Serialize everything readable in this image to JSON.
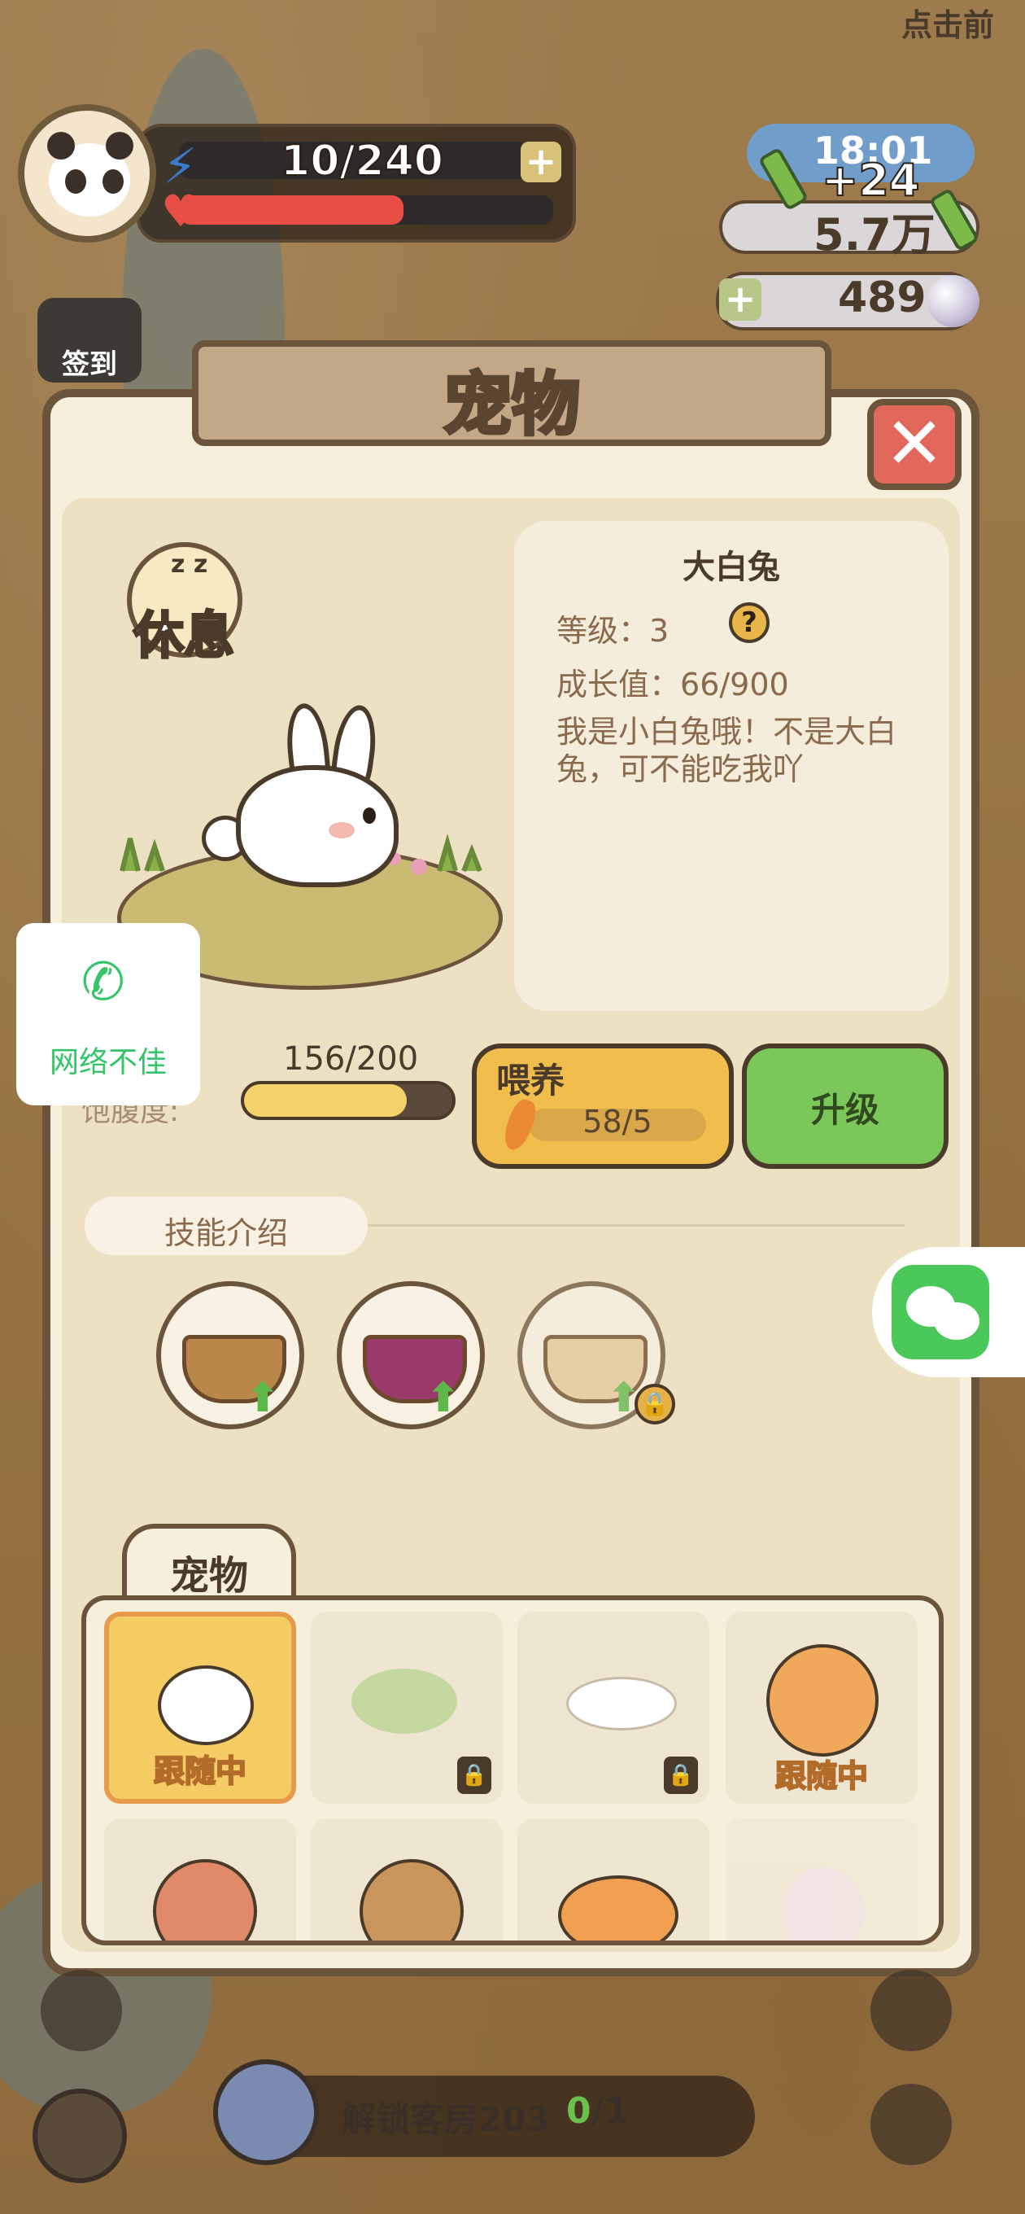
{
  "hud": {
    "energy": "10/240",
    "energy_plus": "+",
    "health_fraction": 0.6,
    "time": "18:01",
    "bamboo_gain": "+24",
    "bamboo_total": "5.7万",
    "pearl_plus": "+",
    "pearls": "489",
    "top_hint": "点击前",
    "checkin_label": "签到"
  },
  "dialog": {
    "title": "宠物",
    "close_label": "✕",
    "status_label": "休息",
    "status_zz": "z z",
    "pet": {
      "name": "大白兔",
      "level_label": "等级：",
      "level": "3",
      "growth_label": "成长值：",
      "growth": "66/900",
      "description": "我是小白兔哦！不是大白兔，可不能吃我吖",
      "help_icon": "?"
    },
    "satiety": {
      "label": "饱腹度:",
      "value": "156/200",
      "fraction": 0.78
    },
    "feed": {
      "label": "喂养",
      "cost": "58/5"
    },
    "upgrade_label": "升级",
    "skills": {
      "title": "技能介绍",
      "items": [
        {
          "name": "potato-basket",
          "locked": false
        },
        {
          "name": "purple-basket",
          "locked": false
        },
        {
          "name": "carrot-basket",
          "locked": true
        }
      ]
    },
    "pets_tab": "宠物",
    "pets": [
      {
        "name": "rabbit",
        "status": "跟随中",
        "selected": true,
        "locked": false
      },
      {
        "name": "bird",
        "status": "",
        "selected": false,
        "locked": true
      },
      {
        "name": "cat",
        "status": "",
        "selected": false,
        "locked": true
      },
      {
        "name": "shiba",
        "status": "跟随中",
        "selected": false,
        "locked": false
      },
      {
        "name": "dinosaur",
        "status": "",
        "selected": false,
        "locked": false
      },
      {
        "name": "deer",
        "status": "",
        "selected": false,
        "locked": false
      },
      {
        "name": "tiger",
        "status": "",
        "selected": false,
        "locked": false
      },
      {
        "name": "fairy",
        "status": "",
        "selected": false,
        "locked": false
      }
    ]
  },
  "network": {
    "icon": "phone-icon",
    "label": "网络不佳"
  },
  "bottom": {
    "unlock_label": "解锁客房203",
    "progress_current": "0",
    "progress_total": "/1"
  },
  "colors": {
    "accent_green": "#7cc75a",
    "accent_yellow": "#f1be4d",
    "panel": "#f6efdc",
    "border": "#6a543b"
  }
}
